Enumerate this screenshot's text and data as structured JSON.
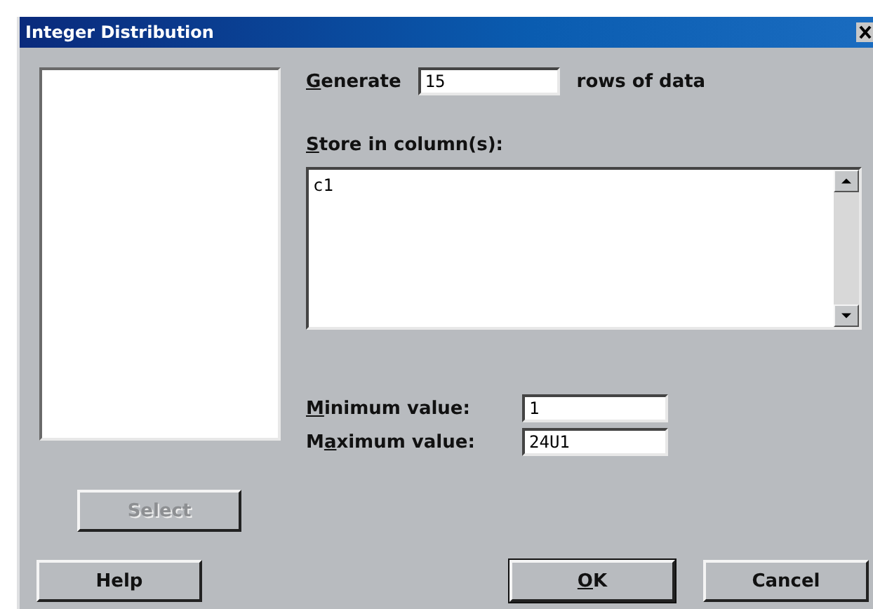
{
  "window": {
    "title": "Integer Distribution"
  },
  "generate": {
    "label": [
      {
        "text": "G",
        "underlined": true
      },
      {
        "text": "enerate",
        "underlined": false
      }
    ],
    "value": "15",
    "suffix": "rows of data"
  },
  "store": {
    "label": [
      {
        "text": "S",
        "underlined": true
      },
      {
        "text": "tore in column(s):",
        "underlined": false
      }
    ],
    "value": "c1"
  },
  "fields": [
    {
      "label": [
        {
          "text": "M",
          "underlined": true
        },
        {
          "text": "inimum value:",
          "underlined": false
        }
      ],
      "value": "1"
    },
    {
      "label": [
        {
          "text": "M",
          "underlined": false
        },
        {
          "text": "a",
          "underlined": true
        },
        {
          "text": "ximum value:",
          "underlined": false
        }
      ],
      "value": "24U1"
    }
  ],
  "select_button": {
    "label": "Select",
    "disabled": true
  },
  "buttons": [
    {
      "label": [
        {
          "text": "Help",
          "underlined": false
        }
      ],
      "kind": "plain"
    },
    {
      "label": [
        {
          "text": "O",
          "underlined": true
        },
        {
          "text": "K",
          "underlined": false
        }
      ],
      "kind": "default"
    },
    {
      "label": [
        {
          "text": "Cancel",
          "underlined": false
        }
      ],
      "kind": "plain"
    }
  ]
}
